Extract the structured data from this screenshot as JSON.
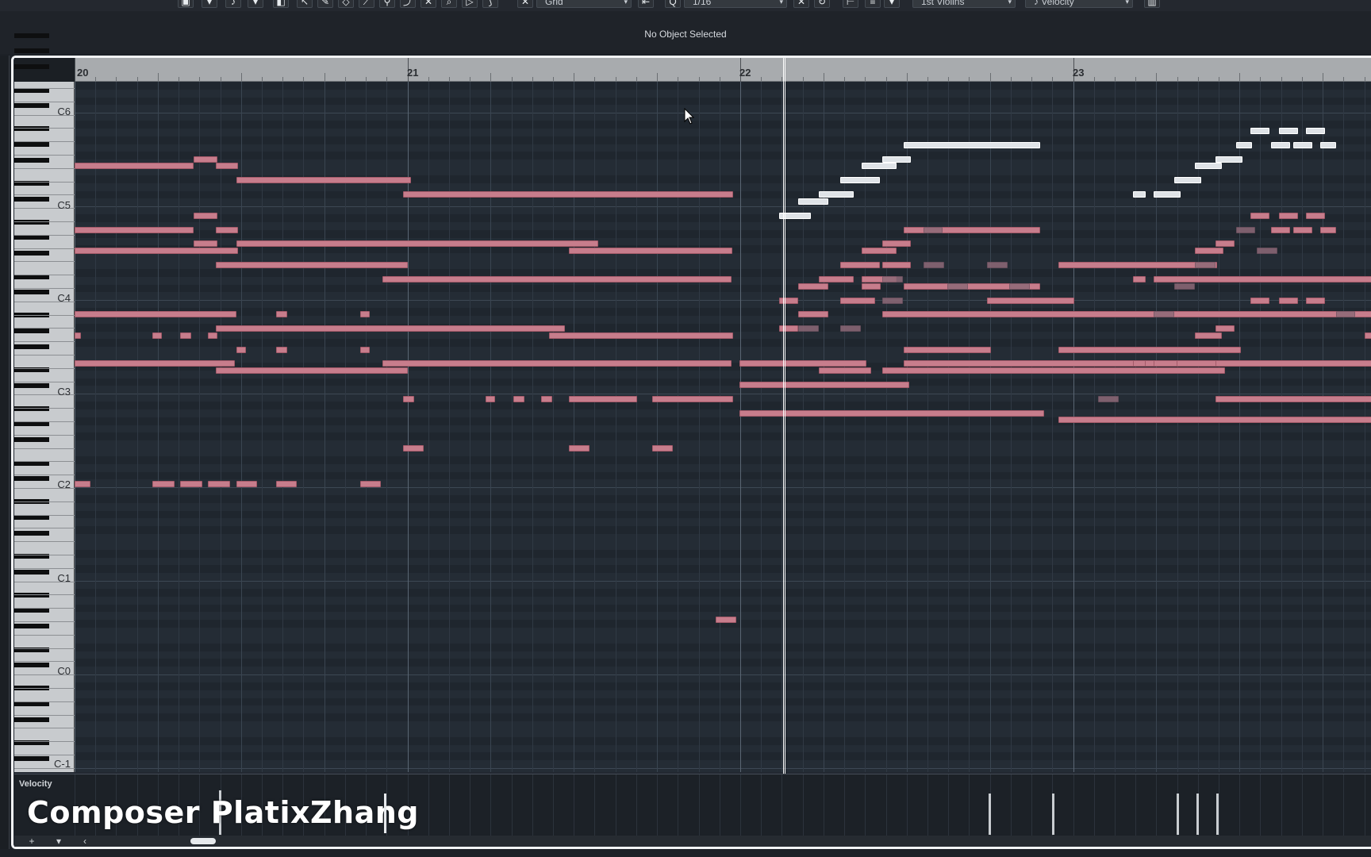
{
  "toolbar": {
    "quantize_mode": "Grid",
    "quantize_value": "1/16",
    "track_name": "1st Violins",
    "controller_lane": "Velocity"
  },
  "status": {
    "info_line": "No Object Selected"
  },
  "ruler": {
    "bars": [
      "20",
      "21",
      "22",
      "23"
    ]
  },
  "keyboard": {
    "octave_labels": [
      "C6",
      "C5",
      "C4",
      "C3",
      "C2",
      "C1",
      "C0",
      "C-1"
    ]
  },
  "velocity_lane": {
    "label": "Velocity"
  },
  "bottom_bar": {
    "add_label": "+",
    "menu_label": "▾",
    "scroll_left_label": "‹"
  },
  "overlay": {
    "watermark": "Composer PlatixZhang"
  },
  "colors": {
    "note": "#c77d8c",
    "selected_note": "#dfe3e7",
    "muted_note": "#8e6a78",
    "grid_bg": "#242c35",
    "frame": "#f2f4f6"
  }
}
